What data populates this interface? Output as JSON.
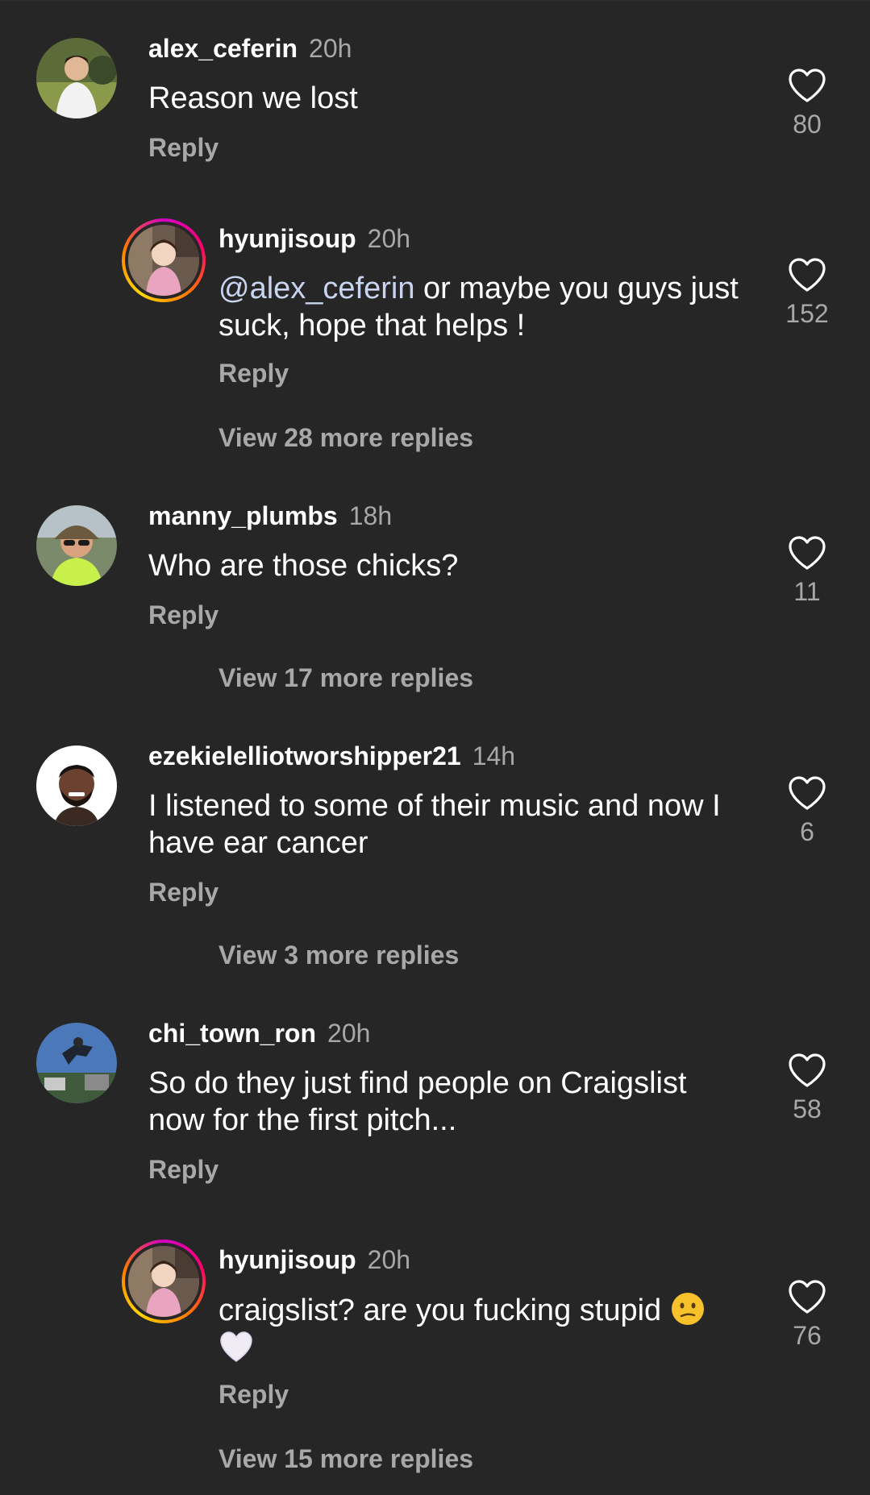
{
  "comments": [
    {
      "username": "alex_ceferin",
      "time": "20h",
      "text": "Reason we lost",
      "reply_label": "Reply",
      "likes": "80"
    },
    {
      "username": "hyunjisoup",
      "time": "20h",
      "mention": "@alex_ceferin",
      "text_line1_rest": " or maybe you guys just",
      "text_line2": "suck, hope that helps !",
      "reply_label": "Reply",
      "likes": "152",
      "more_replies": "View 28 more replies"
    },
    {
      "username": "manny_plumbs",
      "time": "18h",
      "text": "Who are those chicks?",
      "reply_label": "Reply",
      "likes": "11",
      "more_replies": "View 17 more replies"
    },
    {
      "username": "ezekielelliotworshipper21",
      "time": "14h",
      "text_line1": "I listened to some of their music and now I",
      "text_line2": "have ear cancer",
      "reply_label": "Reply",
      "likes": "6",
      "more_replies": "View 3 more replies"
    },
    {
      "username": "chi_town_ron",
      "time": "20h",
      "text_line1": "So do they just find people on Craigslist",
      "text_line2": "now for the first pitch...",
      "reply_label": "Reply",
      "likes": "58"
    },
    {
      "username": "hyunjisoup",
      "time": "20h",
      "text_line1": "craigslist? are you fucking stupid ",
      "emoji1": "confused-face-emoji",
      "emoji2": "white-heart-emoji",
      "reply_label": "Reply",
      "likes": "76",
      "more_replies": "View 15 more replies"
    }
  ],
  "icons": {
    "like": "heart-outline-icon"
  },
  "colors": {
    "background": "#262626",
    "primary_text": "#ffffff",
    "secondary_text": "#a8a8a8",
    "mention": "#c8d4f0"
  }
}
